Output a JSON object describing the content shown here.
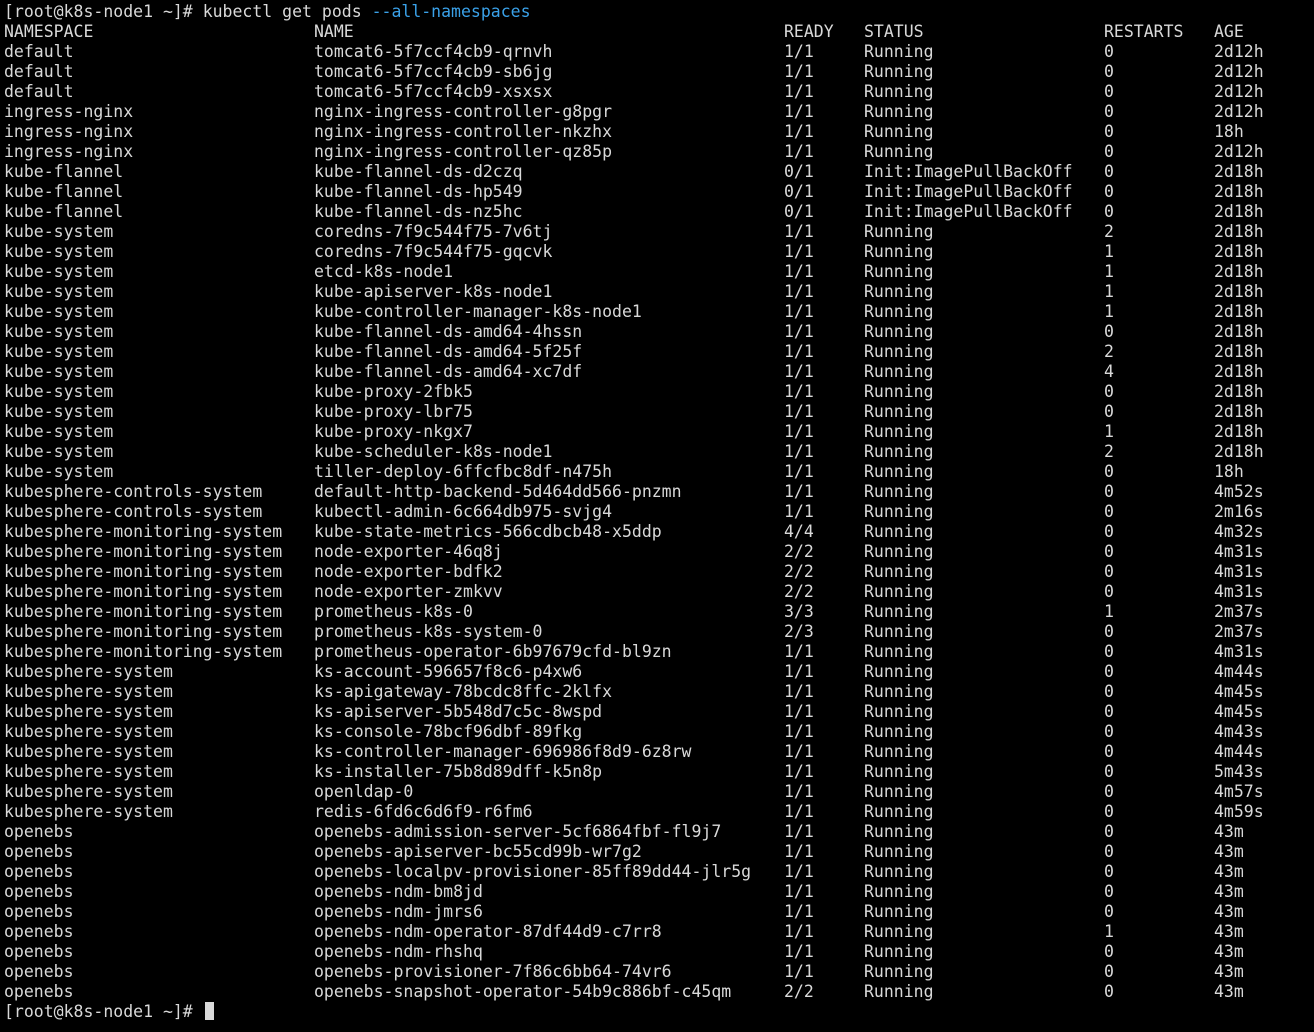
{
  "terminal": {
    "prompt": "[root@k8s-node1 ~]# ",
    "command": "kubectl get pods ",
    "command_flag": "--all-namespaces",
    "final_prompt": "[root@k8s-node1 ~]# ",
    "colors": {
      "background": "#000000",
      "text": "#d9d9d9",
      "flag": "#3aa1e8"
    }
  },
  "table": {
    "headers": [
      "NAMESPACE",
      "NAME",
      "READY",
      "STATUS",
      "RESTARTS",
      "AGE"
    ],
    "rows": [
      [
        "default",
        "tomcat6-5f7ccf4cb9-qrnvh",
        "1/1",
        "Running",
        "0",
        "2d12h"
      ],
      [
        "default",
        "tomcat6-5f7ccf4cb9-sb6jg",
        "1/1",
        "Running",
        "0",
        "2d12h"
      ],
      [
        "default",
        "tomcat6-5f7ccf4cb9-xsxsx",
        "1/1",
        "Running",
        "0",
        "2d12h"
      ],
      [
        "ingress-nginx",
        "nginx-ingress-controller-g8pgr",
        "1/1",
        "Running",
        "0",
        "2d12h"
      ],
      [
        "ingress-nginx",
        "nginx-ingress-controller-nkzhx",
        "1/1",
        "Running",
        "0",
        "18h"
      ],
      [
        "ingress-nginx",
        "nginx-ingress-controller-qz85p",
        "1/1",
        "Running",
        "0",
        "2d12h"
      ],
      [
        "kube-flannel",
        "kube-flannel-ds-d2czq",
        "0/1",
        "Init:ImagePullBackOff",
        "0",
        "2d18h"
      ],
      [
        "kube-flannel",
        "kube-flannel-ds-hp549",
        "0/1",
        "Init:ImagePullBackOff",
        "0",
        "2d18h"
      ],
      [
        "kube-flannel",
        "kube-flannel-ds-nz5hc",
        "0/1",
        "Init:ImagePullBackOff",
        "0",
        "2d18h"
      ],
      [
        "kube-system",
        "coredns-7f9c544f75-7v6tj",
        "1/1",
        "Running",
        "2",
        "2d18h"
      ],
      [
        "kube-system",
        "coredns-7f9c544f75-gqcvk",
        "1/1",
        "Running",
        "1",
        "2d18h"
      ],
      [
        "kube-system",
        "etcd-k8s-node1",
        "1/1",
        "Running",
        "1",
        "2d18h"
      ],
      [
        "kube-system",
        "kube-apiserver-k8s-node1",
        "1/1",
        "Running",
        "1",
        "2d18h"
      ],
      [
        "kube-system",
        "kube-controller-manager-k8s-node1",
        "1/1",
        "Running",
        "1",
        "2d18h"
      ],
      [
        "kube-system",
        "kube-flannel-ds-amd64-4hssn",
        "1/1",
        "Running",
        "0",
        "2d18h"
      ],
      [
        "kube-system",
        "kube-flannel-ds-amd64-5f25f",
        "1/1",
        "Running",
        "2",
        "2d18h"
      ],
      [
        "kube-system",
        "kube-flannel-ds-amd64-xc7df",
        "1/1",
        "Running",
        "4",
        "2d18h"
      ],
      [
        "kube-system",
        "kube-proxy-2fbk5",
        "1/1",
        "Running",
        "0",
        "2d18h"
      ],
      [
        "kube-system",
        "kube-proxy-lbr75",
        "1/1",
        "Running",
        "0",
        "2d18h"
      ],
      [
        "kube-system",
        "kube-proxy-nkgx7",
        "1/1",
        "Running",
        "1",
        "2d18h"
      ],
      [
        "kube-system",
        "kube-scheduler-k8s-node1",
        "1/1",
        "Running",
        "2",
        "2d18h"
      ],
      [
        "kube-system",
        "tiller-deploy-6ffcfbc8df-n475h",
        "1/1",
        "Running",
        "0",
        "18h"
      ],
      [
        "kubesphere-controls-system",
        "default-http-backend-5d464dd566-pnzmn",
        "1/1",
        "Running",
        "0",
        "4m52s"
      ],
      [
        "kubesphere-controls-system",
        "kubectl-admin-6c664db975-svjg4",
        "1/1",
        "Running",
        "0",
        "2m16s"
      ],
      [
        "kubesphere-monitoring-system",
        "kube-state-metrics-566cdbcb48-x5ddp",
        "4/4",
        "Running",
        "0",
        "4m32s"
      ],
      [
        "kubesphere-monitoring-system",
        "node-exporter-46q8j",
        "2/2",
        "Running",
        "0",
        "4m31s"
      ],
      [
        "kubesphere-monitoring-system",
        "node-exporter-bdfk2",
        "2/2",
        "Running",
        "0",
        "4m31s"
      ],
      [
        "kubesphere-monitoring-system",
        "node-exporter-zmkvv",
        "2/2",
        "Running",
        "0",
        "4m31s"
      ],
      [
        "kubesphere-monitoring-system",
        "prometheus-k8s-0",
        "3/3",
        "Running",
        "1",
        "2m37s"
      ],
      [
        "kubesphere-monitoring-system",
        "prometheus-k8s-system-0",
        "2/3",
        "Running",
        "0",
        "2m37s"
      ],
      [
        "kubesphere-monitoring-system",
        "prometheus-operator-6b97679cfd-bl9zn",
        "1/1",
        "Running",
        "0",
        "4m31s"
      ],
      [
        "kubesphere-system",
        "ks-account-596657f8c6-p4xw6",
        "1/1",
        "Running",
        "0",
        "4m44s"
      ],
      [
        "kubesphere-system",
        "ks-apigateway-78bcdc8ffc-2klfx",
        "1/1",
        "Running",
        "0",
        "4m45s"
      ],
      [
        "kubesphere-system",
        "ks-apiserver-5b548d7c5c-8wspd",
        "1/1",
        "Running",
        "0",
        "4m45s"
      ],
      [
        "kubesphere-system",
        "ks-console-78bcf96dbf-89fkg",
        "1/1",
        "Running",
        "0",
        "4m43s"
      ],
      [
        "kubesphere-system",
        "ks-controller-manager-696986f8d9-6z8rw",
        "1/1",
        "Running",
        "0",
        "4m44s"
      ],
      [
        "kubesphere-system",
        "ks-installer-75b8d89dff-k5n8p",
        "1/1",
        "Running",
        "0",
        "5m43s"
      ],
      [
        "kubesphere-system",
        "openldap-0",
        "1/1",
        "Running",
        "0",
        "4m57s"
      ],
      [
        "kubesphere-system",
        "redis-6fd6c6d6f9-r6fm6",
        "1/1",
        "Running",
        "0",
        "4m59s"
      ],
      [
        "openebs",
        "openebs-admission-server-5cf6864fbf-fl9j7",
        "1/1",
        "Running",
        "0",
        "43m"
      ],
      [
        "openebs",
        "openebs-apiserver-bc55cd99b-wr7g2",
        "1/1",
        "Running",
        "0",
        "43m"
      ],
      [
        "openebs",
        "openebs-localpv-provisioner-85ff89dd44-jlr5g",
        "1/1",
        "Running",
        "0",
        "43m"
      ],
      [
        "openebs",
        "openebs-ndm-bm8jd",
        "1/1",
        "Running",
        "0",
        "43m"
      ],
      [
        "openebs",
        "openebs-ndm-jmrs6",
        "1/1",
        "Running",
        "0",
        "43m"
      ],
      [
        "openebs",
        "openebs-ndm-operator-87df44d9-c7rr8",
        "1/1",
        "Running",
        "1",
        "43m"
      ],
      [
        "openebs",
        "openebs-ndm-rhshq",
        "1/1",
        "Running",
        "0",
        "43m"
      ],
      [
        "openebs",
        "openebs-provisioner-7f86c6bb64-74vr6",
        "1/1",
        "Running",
        "0",
        "43m"
      ],
      [
        "openebs",
        "openebs-snapshot-operator-54b9c886bf-c45qm",
        "2/2",
        "Running",
        "0",
        "43m"
      ]
    ]
  }
}
